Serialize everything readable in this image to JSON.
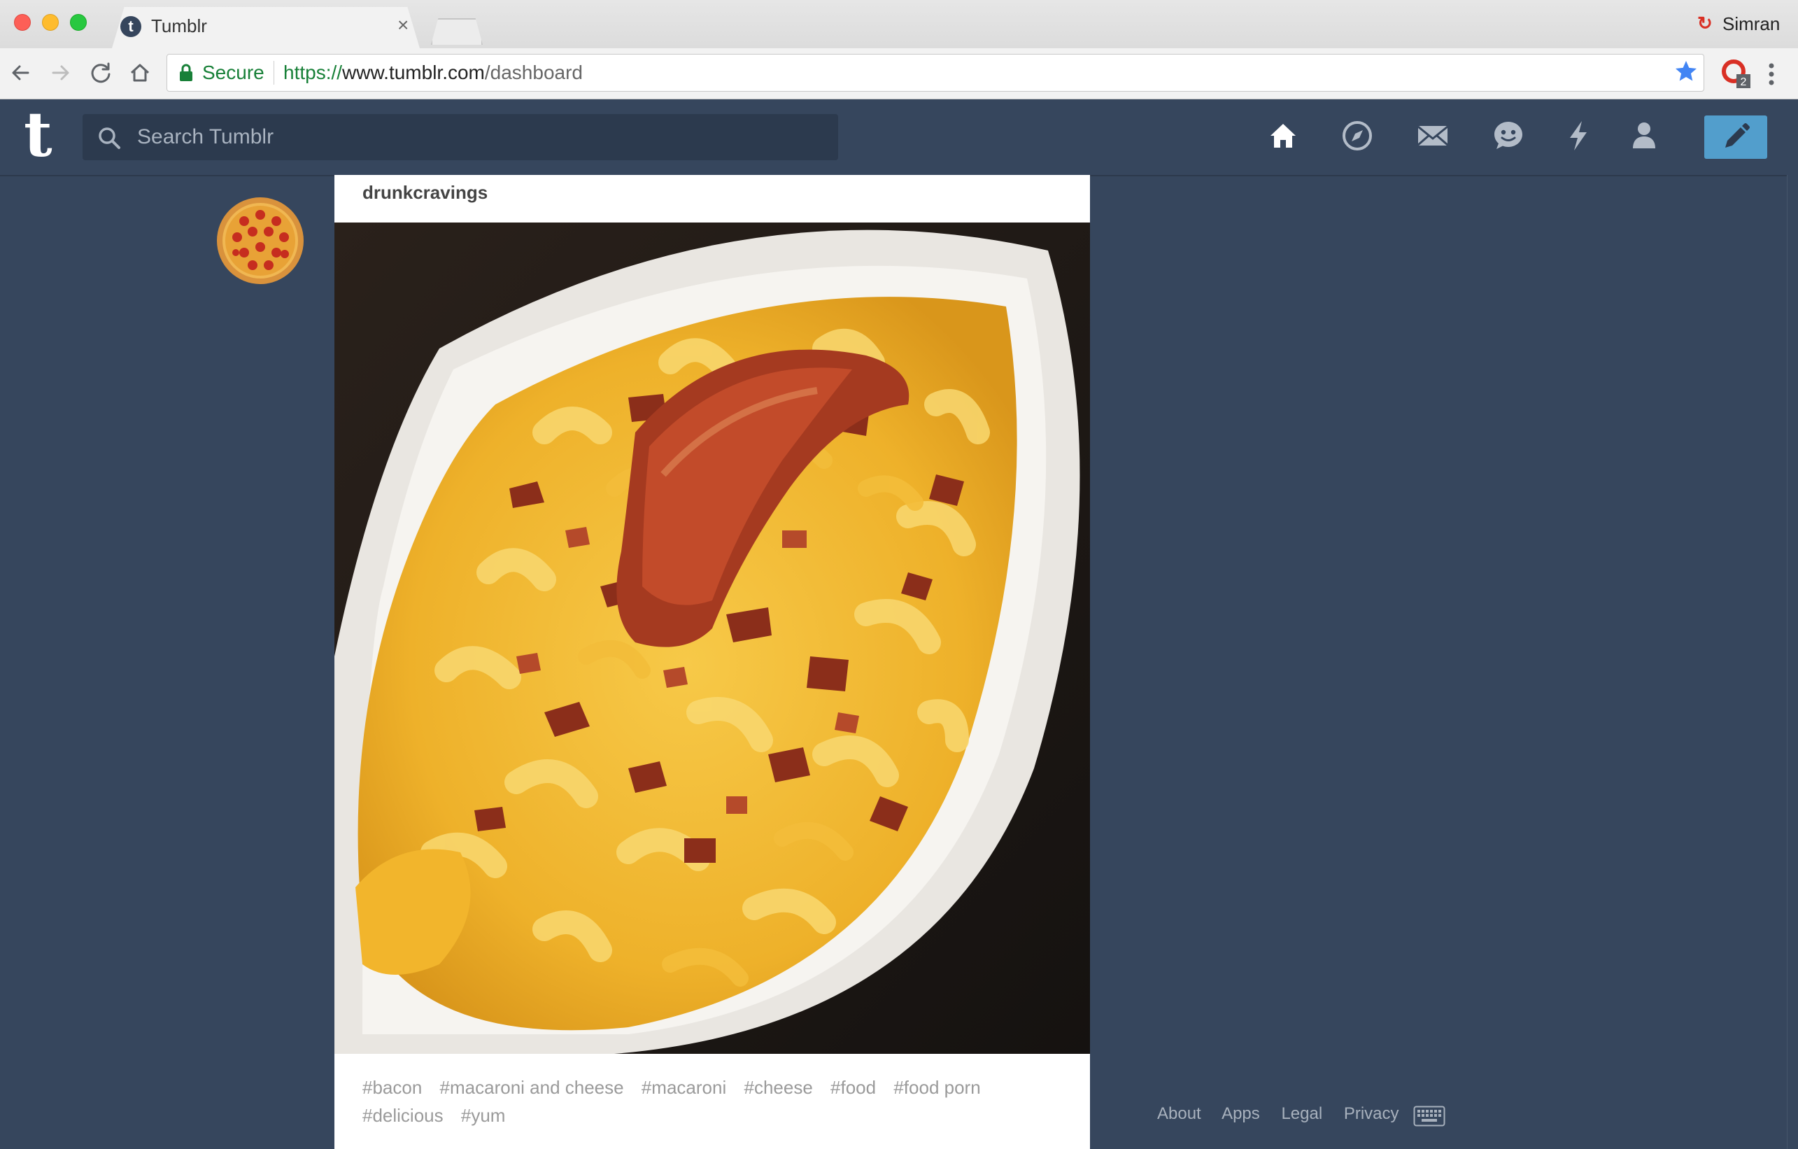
{
  "browser": {
    "tab_title": "Tumblr",
    "tab_favicon_letter": "t",
    "tab_close": "×",
    "profile_name": "Simran",
    "secure_label": "Secure",
    "url_scheme": "https://",
    "url_host": "www.tumblr.com",
    "url_path": "/dashboard",
    "extension_badge": "2"
  },
  "header": {
    "logo": "t",
    "search_placeholder": "Search Tumblr",
    "icons": [
      "home-icon",
      "explore-icon",
      "inbox-icon",
      "messaging-icon",
      "activity-icon",
      "account-icon",
      "compose-icon"
    ],
    "accent_color": "#529ecc",
    "background_color": "#36465d"
  },
  "post": {
    "author": "drunkcravings",
    "photo": "macaroni and cheese with bacon on a white plate",
    "tags": [
      "#bacon",
      "#macaroni and cheese",
      "#macaroni",
      "#cheese",
      "#food",
      "#food porn",
      "#delicious",
      "#yum"
    ]
  },
  "footer": {
    "links": [
      "About",
      "Apps",
      "Legal",
      "Privacy"
    ]
  }
}
